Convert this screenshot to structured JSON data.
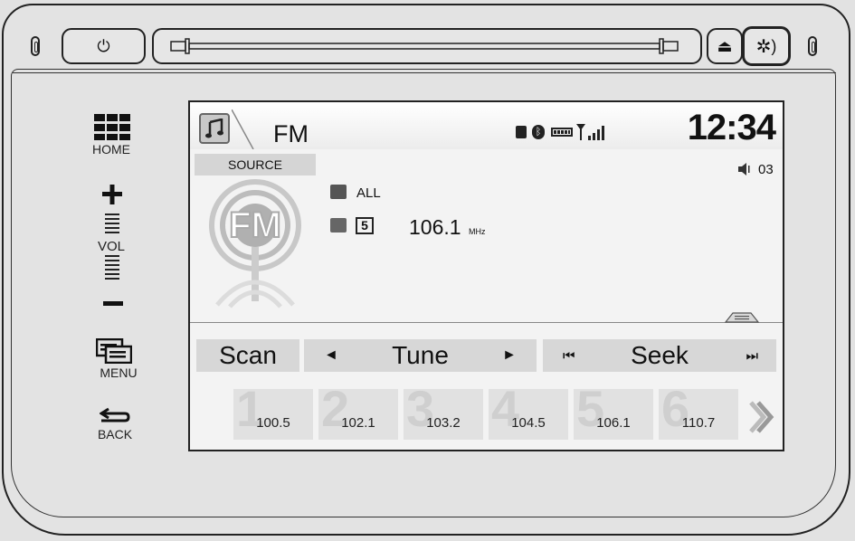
{
  "device": {
    "hardware_buttons": {
      "power_icon": "⏻",
      "eject_icon": "⏏",
      "display_icon": "✲"
    }
  },
  "side_controls": {
    "home_label": "HOME",
    "vol_label": "VOL",
    "menu_label": "MENU",
    "back_label": "BACK"
  },
  "screen": {
    "source_title": "FM",
    "time": "12:34",
    "source_button": "SOURCE",
    "volume_level": "03",
    "logo_text": "FM",
    "category": "ALL",
    "preset_number": "5",
    "frequency": "106.1",
    "frequency_unit": "MHz",
    "controls": {
      "scan_label": "Scan",
      "tune_label": "Tune",
      "seek_label": "Seek"
    },
    "presets": [
      {
        "number": "1",
        "frequency": "100.5"
      },
      {
        "number": "2",
        "frequency": "102.1"
      },
      {
        "number": "3",
        "frequency": "103.2"
      },
      {
        "number": "4",
        "frequency": "104.5"
      },
      {
        "number": "5",
        "frequency": "106.1"
      },
      {
        "number": "6",
        "frequency": "110.7"
      }
    ]
  },
  "colors": {
    "bezel": "#e3e3e3",
    "screen_bg": "#f3f3f3",
    "button_bg": "#d7d7d7",
    "outline": "#222222"
  }
}
